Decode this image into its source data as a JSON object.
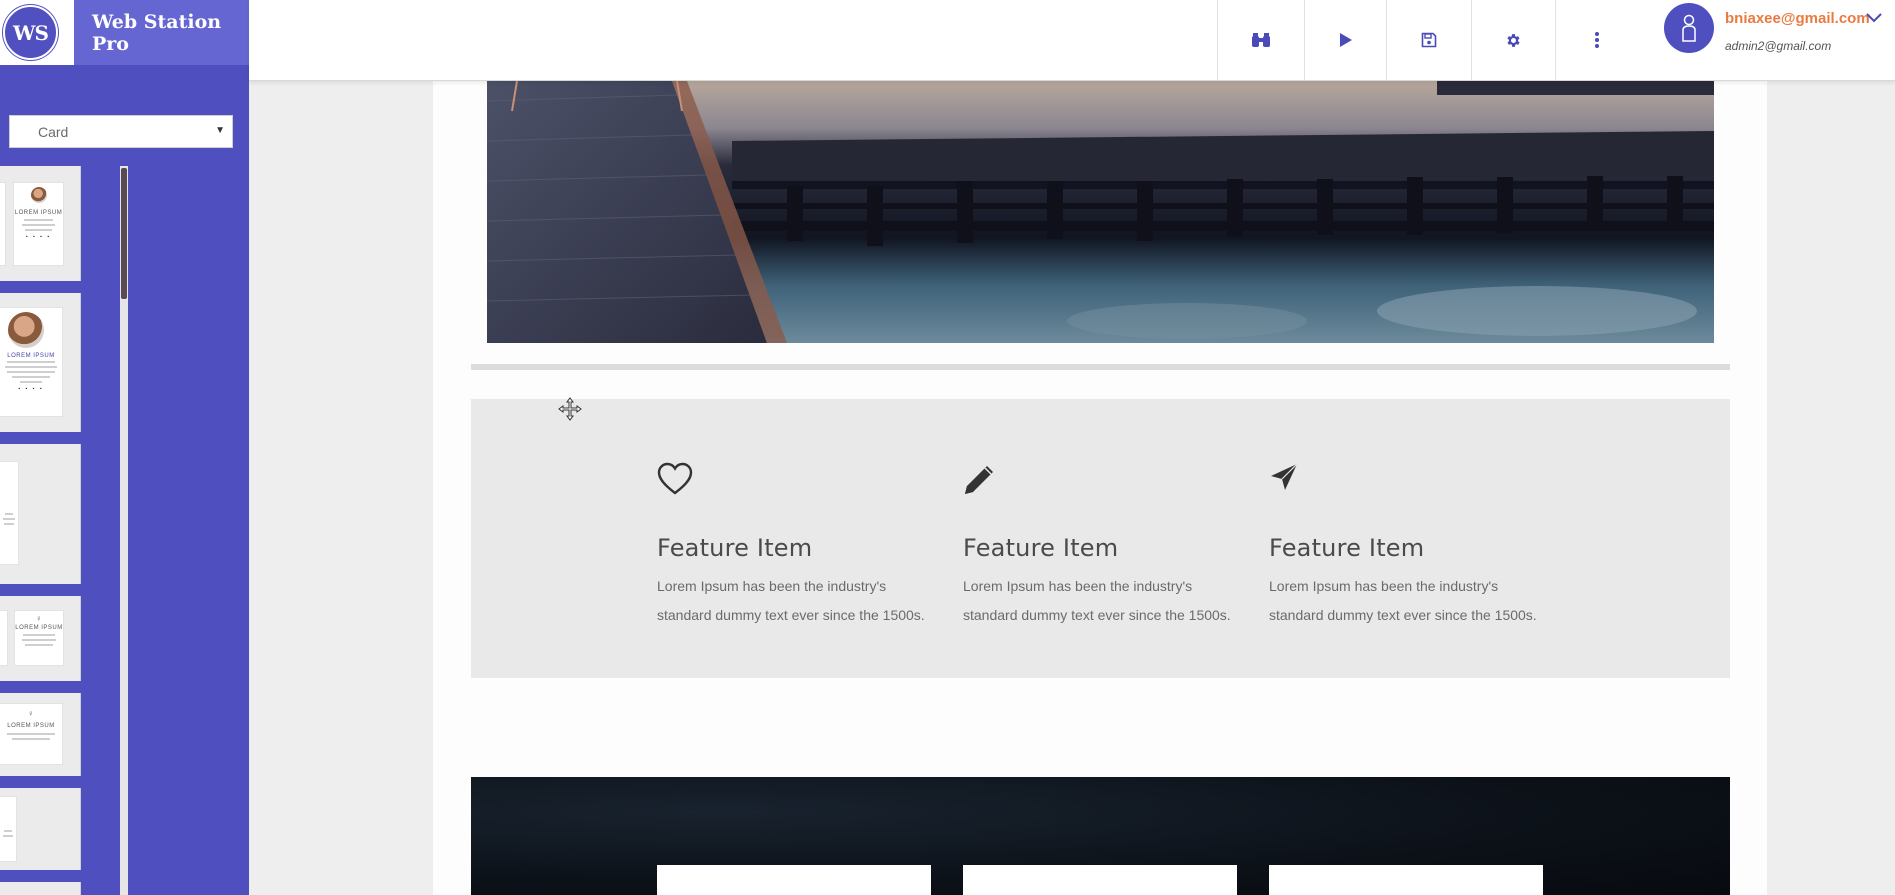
{
  "app": {
    "logo_text": "WS",
    "title": "Web Station Pro"
  },
  "sidebar": {
    "category_select": {
      "value": "Card"
    },
    "thumbnails": [
      {
        "label": "LOREM IPSUM"
      },
      {
        "label": "LOREM IPSUM"
      },
      {
        "label": ""
      },
      {
        "label": "LOREM IPSUM"
      },
      {
        "label": "LOREM IPSUM"
      },
      {
        "label": ""
      }
    ]
  },
  "toolbar": {
    "buttons": [
      {
        "name": "preview-binoculars",
        "icon": "binoculars-icon"
      },
      {
        "name": "play",
        "icon": "play-icon"
      },
      {
        "name": "save",
        "icon": "save-icon"
      },
      {
        "name": "settings",
        "icon": "gear-icon"
      },
      {
        "name": "more",
        "icon": "more-vertical-icon"
      }
    ]
  },
  "user": {
    "email": "bniaxee@gmail.com",
    "secondary": "admin2@gmail.com"
  },
  "features": [
    {
      "icon": "heart-icon",
      "title": "Feature Item",
      "text": "Lorem Ipsum has been the industry's standard dummy text ever since the 1500s."
    },
    {
      "icon": "pencil-icon",
      "title": "Feature Item",
      "text": "Lorem Ipsum has been the industry's standard dummy text ever since the 1500s."
    },
    {
      "icon": "paper-plane-icon",
      "title": "Feature Item",
      "text": "Lorem Ipsum has been the industry's standard dummy text ever since the 1500s."
    }
  ],
  "colors": {
    "sidebar": "#4f4fbf",
    "brand_bar": "#6666d2",
    "user_email": "#e87b41",
    "icons": "#4a4ab8"
  }
}
